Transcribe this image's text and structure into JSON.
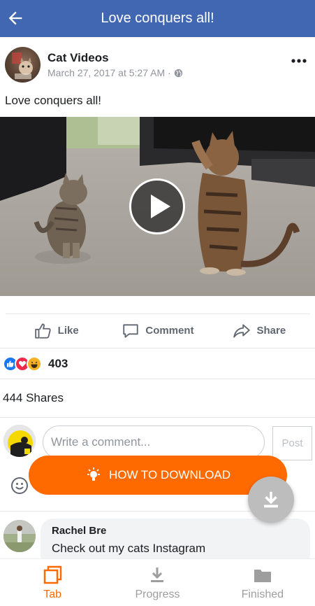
{
  "header": {
    "title": "Love conquers all!"
  },
  "post": {
    "page_name": "Cat Videos",
    "timestamp": "March 27, 2017 at 5:27 AM · ",
    "text": "Love conquers all!"
  },
  "actions": {
    "like": "Like",
    "comment": "Comment",
    "share": "Share"
  },
  "reactions": {
    "count": "403"
  },
  "shares": {
    "label": "444 Shares"
  },
  "comment_box": {
    "placeholder": "Write a comment...",
    "post_label": "Post"
  },
  "overlay": {
    "how_to_download": "HOW TO DOWNLOAD"
  },
  "comment": {
    "author": "Rachel Bre",
    "text": "Check out my cats Instagram"
  },
  "bottom_nav": {
    "items": [
      {
        "label": "Tab",
        "icon": "tab-icon"
      },
      {
        "label": "Progress",
        "icon": "download-icon"
      },
      {
        "label": "Finished",
        "icon": "folder-icon"
      }
    ]
  },
  "colors": {
    "header_bg": "#4267b2",
    "accent": "#ff6a00",
    "text_secondary": "#90949c",
    "fab_bg": "#bdbdbd"
  }
}
